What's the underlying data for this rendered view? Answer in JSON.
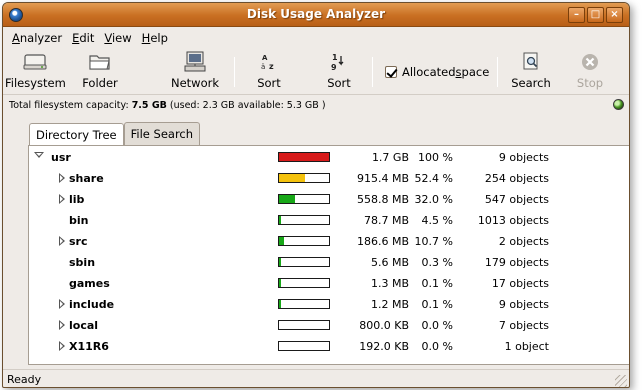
{
  "window": {
    "title": "Disk Usage Analyzer"
  },
  "menubar": [
    {
      "mnemonic": "A",
      "rest": "nalyzer"
    },
    {
      "mnemonic": "E",
      "rest": "dit"
    },
    {
      "mnemonic": "V",
      "rest": "iew"
    },
    {
      "mnemonic": "H",
      "rest": "elp"
    }
  ],
  "toolbar": {
    "filesystem": "Filesystem",
    "folder": "Folder",
    "network": "Network",
    "sort_name": "Sort",
    "sort_size": "Sort",
    "allocated_pre": "Allocated ",
    "allocated_mnemonic": "s",
    "allocated_post": "pace",
    "allocated_checked": true,
    "search": "Search",
    "stop": "Stop"
  },
  "capacity": {
    "prefix": "Total filesystem capacity: ",
    "total": "7.5 GB",
    "detail": " (used: 2.3 GB available: 5.3 GB )"
  },
  "tabs": [
    {
      "label": "Directory Tree",
      "active": true
    },
    {
      "label": "File Search",
      "active": false
    }
  ],
  "tree": [
    {
      "name": "usr",
      "expander": "expanded",
      "indent": 0,
      "fraction": 1.0,
      "color": "#d71a1a",
      "size": "1.7 GB",
      "percent": "100 %",
      "objects": "9 objects"
    },
    {
      "name": "share",
      "expander": "collapsed",
      "indent": 1,
      "fraction": 0.524,
      "color": "#f4c20d",
      "size": "915.4 MB",
      "percent": "52.4 %",
      "objects": "254 objects"
    },
    {
      "name": "lib",
      "expander": "collapsed",
      "indent": 1,
      "fraction": 0.32,
      "color": "#18a818",
      "size": "558.8 MB",
      "percent": "32.0 %",
      "objects": "547 objects"
    },
    {
      "name": "bin",
      "expander": "none",
      "indent": 1,
      "fraction": 0.045,
      "color": "#18a818",
      "size": "78.7 MB",
      "percent": "4.5 %",
      "objects": "1013 objects"
    },
    {
      "name": "src",
      "expander": "collapsed",
      "indent": 1,
      "fraction": 0.107,
      "color": "#18a818",
      "size": "186.6 MB",
      "percent": "10.7 %",
      "objects": "2 objects"
    },
    {
      "name": "sbin",
      "expander": "none",
      "indent": 1,
      "fraction": 0.003,
      "color": "#18a818",
      "size": "5.6 MB",
      "percent": "0.3 %",
      "objects": "179 objects"
    },
    {
      "name": "games",
      "expander": "none",
      "indent": 1,
      "fraction": 0.001,
      "color": "#18a818",
      "size": "1.3 MB",
      "percent": "0.1 %",
      "objects": "17 objects"
    },
    {
      "name": "include",
      "expander": "collapsed",
      "indent": 1,
      "fraction": 0.001,
      "color": "#18a818",
      "size": "1.2 MB",
      "percent": "0.1 %",
      "objects": "9 objects"
    },
    {
      "name": "local",
      "expander": "collapsed",
      "indent": 1,
      "fraction": 0.0,
      "color": "#18a818",
      "size": "800.0 KB",
      "percent": "0.0 %",
      "objects": "7 objects"
    },
    {
      "name": "X11R6",
      "expander": "collapsed",
      "indent": 1,
      "fraction": 0.0,
      "color": "#18a818",
      "size": "192.0 KB",
      "percent": "0.0 %",
      "objects": "1 object"
    }
  ],
  "statusbar": {
    "text": "Ready"
  }
}
